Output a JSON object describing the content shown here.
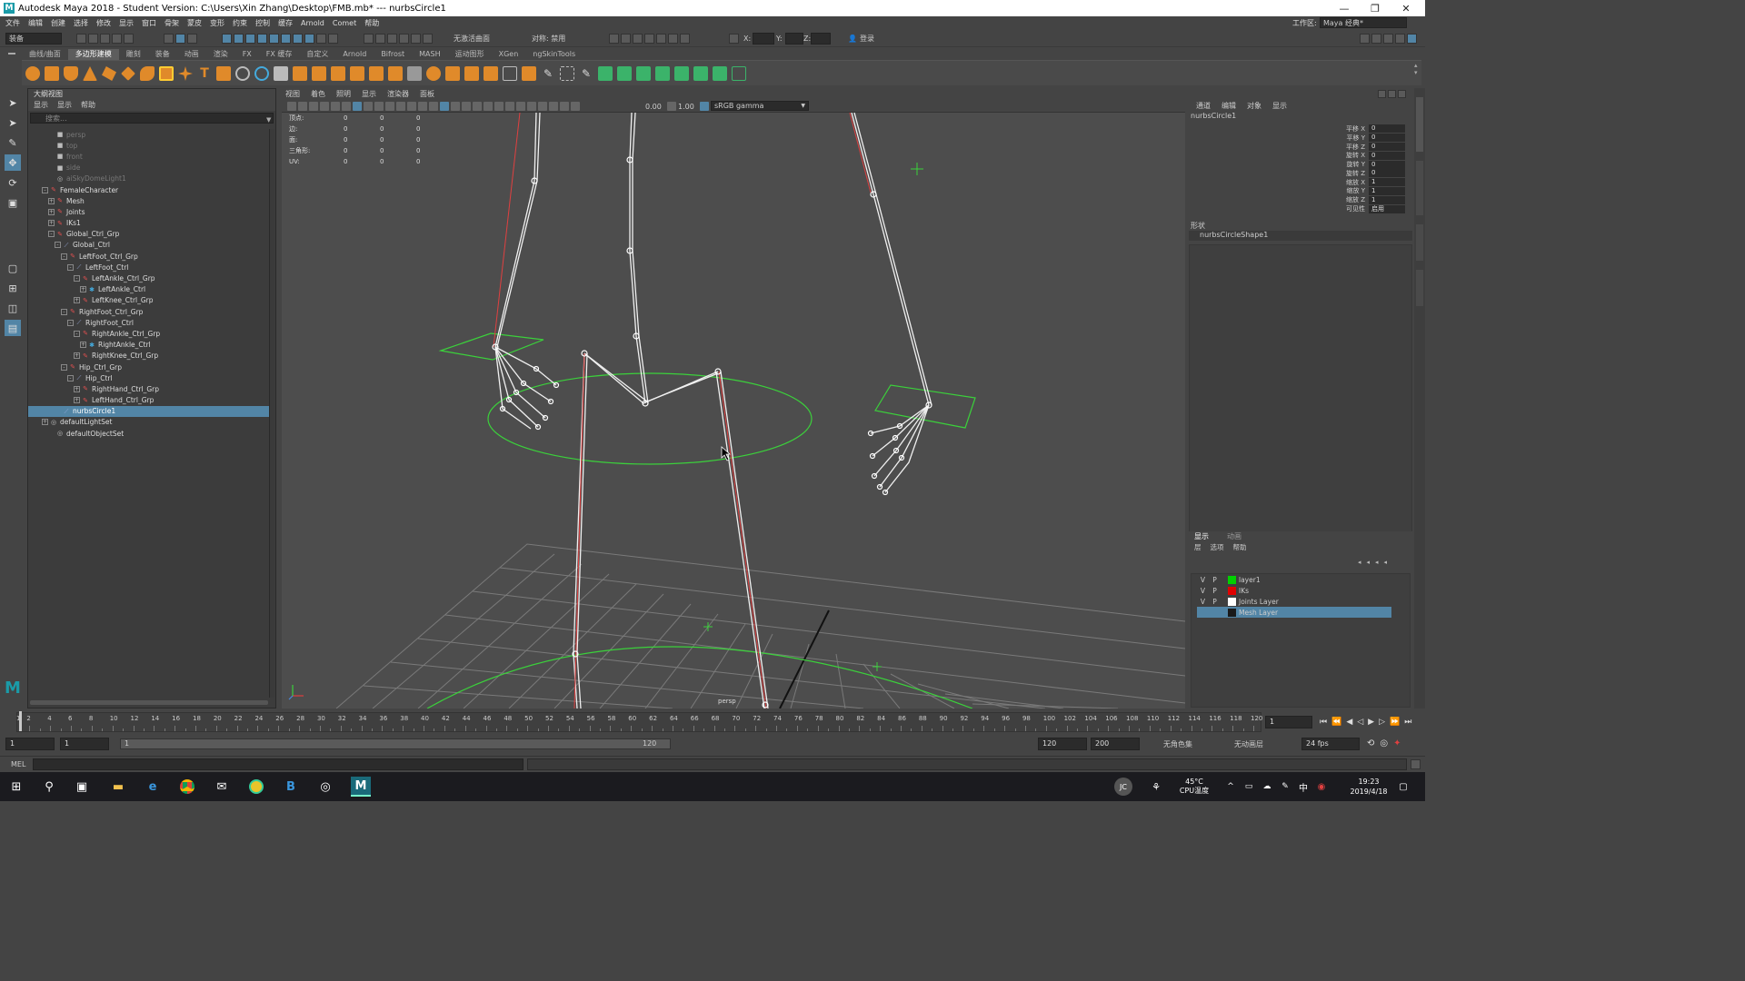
{
  "window": {
    "title": "Autodesk Maya 2018 - Student Version: C:\\Users\\Xin Zhang\\Desktop\\FMB.mb*  ---  nurbsCircle1",
    "logo": "M",
    "controls": [
      "—",
      "❐",
      "✕"
    ]
  },
  "menubar": {
    "items": [
      "文件",
      "编辑",
      "创建",
      "选择",
      "修改",
      "显示",
      "窗口",
      "骨架",
      "蒙皮",
      "变形",
      "约束",
      "控制",
      "缓存",
      "Arnold",
      "Comet",
      "帮助"
    ],
    "workspace_label": "工作区:",
    "workspace_value": "Maya 经典*"
  },
  "statusline": {
    "mode": "装备",
    "live_surface": "无激活曲面",
    "symmetry": "对称: 禁用",
    "x_label": "X:",
    "y_label": "Y:",
    "z_label": "Z:",
    "login": "登录"
  },
  "shelf": {
    "tabs": [
      "曲线/曲面",
      "多边形建模",
      "雕刻",
      "装备",
      "动画",
      "渲染",
      "FX",
      "FX 缓存",
      "自定义",
      "Arnold",
      "Bifrost",
      "MASH",
      "运动图形",
      "XGen",
      "ngSkinTools"
    ],
    "active_tab": 1
  },
  "outliner": {
    "title": "大纲视图",
    "menu": [
      "显示",
      "显示",
      "帮助"
    ],
    "search_placeholder": "搜索...",
    "nodes": [
      {
        "label": "persp",
        "depth": 2,
        "icon": "cam",
        "dim": true,
        "exp": ""
      },
      {
        "label": "top",
        "depth": 2,
        "icon": "cam",
        "dim": true,
        "exp": ""
      },
      {
        "label": "front",
        "depth": 2,
        "icon": "cam",
        "dim": true,
        "exp": ""
      },
      {
        "label": "side",
        "depth": 2,
        "icon": "cam",
        "dim": true,
        "exp": ""
      },
      {
        "label": "aiSkyDomeLight1",
        "depth": 2,
        "icon": "set",
        "dim": true,
        "exp": ""
      },
      {
        "label": "FemaleCharacter",
        "depth": 1,
        "icon": "tf",
        "exp": "-"
      },
      {
        "label": "Mesh",
        "depth": 2,
        "icon": "tf",
        "exp": "+"
      },
      {
        "label": "Joints",
        "depth": 2,
        "icon": "tf",
        "exp": "+"
      },
      {
        "label": "IKs1",
        "depth": 2,
        "icon": "tf",
        "exp": "+"
      },
      {
        "label": "Global_Ctrl_Grp",
        "depth": 2,
        "icon": "tf",
        "exp": "-"
      },
      {
        "label": "Global_Ctrl",
        "depth": 3,
        "icon": "crv",
        "exp": "-"
      },
      {
        "label": "LeftFoot_Ctrl_Grp",
        "depth": 4,
        "icon": "tf",
        "exp": "-"
      },
      {
        "label": "LeftFoot_Ctrl",
        "depth": 5,
        "icon": "crv",
        "exp": "-"
      },
      {
        "label": "LeftAnkle_Ctrl_Grp",
        "depth": 6,
        "icon": "tf",
        "exp": "-"
      },
      {
        "label": "LeftAnkle_Ctrl",
        "depth": 7,
        "icon": "ik",
        "exp": "+"
      },
      {
        "label": "LeftKnee_Ctrl_Grp",
        "depth": 6,
        "icon": "tf",
        "exp": "+"
      },
      {
        "label": "RightFoot_Ctrl_Grp",
        "depth": 4,
        "icon": "tf",
        "exp": "-"
      },
      {
        "label": "RightFoot_Ctrl",
        "depth": 5,
        "icon": "crv",
        "exp": "-"
      },
      {
        "label": "RightAnkle_Ctrl_Grp",
        "depth": 6,
        "icon": "tf",
        "exp": "-"
      },
      {
        "label": "RightAnkle_Ctrl",
        "depth": 7,
        "icon": "ik",
        "exp": "+"
      },
      {
        "label": "RightKnee_Ctrl_Grp",
        "depth": 6,
        "icon": "tf",
        "exp": "+"
      },
      {
        "label": "Hip_Ctrl_Grp",
        "depth": 4,
        "icon": "tf",
        "exp": "-"
      },
      {
        "label": "Hip_Ctrl",
        "depth": 5,
        "icon": "crv",
        "exp": "-"
      },
      {
        "label": "RightHand_Ctrl_Grp",
        "depth": 6,
        "icon": "tf",
        "exp": "+"
      },
      {
        "label": "LeftHand_Ctrl_Grp",
        "depth": 6,
        "icon": "tf",
        "exp": "+"
      },
      {
        "label": "nurbsCircle1",
        "depth": 3,
        "icon": "crv",
        "exp": "",
        "selected": true
      },
      {
        "label": "defaultLightSet",
        "depth": 1,
        "icon": "set",
        "exp": "+"
      },
      {
        "label": "defaultObjectSet",
        "depth": 2,
        "icon": "set",
        "exp": ""
      }
    ]
  },
  "viewport": {
    "menu": [
      "视图",
      "着色",
      "照明",
      "显示",
      "渲染器",
      "面板"
    ],
    "exposure": "0.00",
    "gamma": "1.00",
    "color_space": "sRGB gamma",
    "camera": "persp",
    "hud": [
      {
        "label": "顶点:",
        "v": [
          "0",
          "0",
          "0"
        ]
      },
      {
        "label": "边:",
        "v": [
          "0",
          "0",
          "0"
        ]
      },
      {
        "label": "面:",
        "v": [
          "0",
          "0",
          "0"
        ]
      },
      {
        "label": "三角形:",
        "v": [
          "0",
          "0",
          "0"
        ]
      },
      {
        "label": "UV:",
        "v": [
          "0",
          "0",
          "0"
        ]
      }
    ]
  },
  "channelbox": {
    "menu": [
      "通道",
      "编辑",
      "对象",
      "显示"
    ],
    "object": "nurbsCircle1",
    "attrs": [
      {
        "label": "平移 X",
        "value": "0"
      },
      {
        "label": "平移 Y",
        "value": "0"
      },
      {
        "label": "平移 Z",
        "value": "0"
      },
      {
        "label": "旋转 X",
        "value": "0"
      },
      {
        "label": "旋转 Y",
        "value": "0"
      },
      {
        "label": "旋转 Z",
        "value": "0"
      },
      {
        "label": "缩放 X",
        "value": "1"
      },
      {
        "label": "缩放 Y",
        "value": "1"
      },
      {
        "label": "缩放 Z",
        "value": "1"
      },
      {
        "label": "可见性",
        "value": "启用"
      }
    ],
    "shapes_label": "形状",
    "shape": "nurbsCircleShape1"
  },
  "layers": {
    "tabs": [
      "显示",
      "动画"
    ],
    "menu": [
      "层",
      "选项",
      "帮助"
    ],
    "items": [
      {
        "v": "V",
        "p": "P",
        "color": "#00d000",
        "name": "layer1"
      },
      {
        "v": "V",
        "p": "P",
        "color": "#e00000",
        "name": "IKs"
      },
      {
        "v": "V",
        "p": "P",
        "color": "#ffffff",
        "name": "Joints Layer"
      },
      {
        "v": "",
        "p": "",
        "color": "#1a1a1a",
        "name": "Mesh Layer",
        "selected": true
      }
    ]
  },
  "timeline": {
    "start": 1,
    "end": 120,
    "current_frame": "1",
    "range_start": "1",
    "playback_start": "1",
    "range_inner_start": "1",
    "range_inner_end": "120",
    "range_end": "120",
    "anim_end": "200",
    "char_set": "无角色集",
    "anim_layer": "无动画层",
    "fps": "24 fps"
  },
  "cmdline": {
    "label": "MEL"
  },
  "taskbar": {
    "user_initials": "JC",
    "temp": "45°C",
    "cpu_label": "CPU温度",
    "ime": "中",
    "time": "19:23",
    "date": "2019/4/18"
  }
}
